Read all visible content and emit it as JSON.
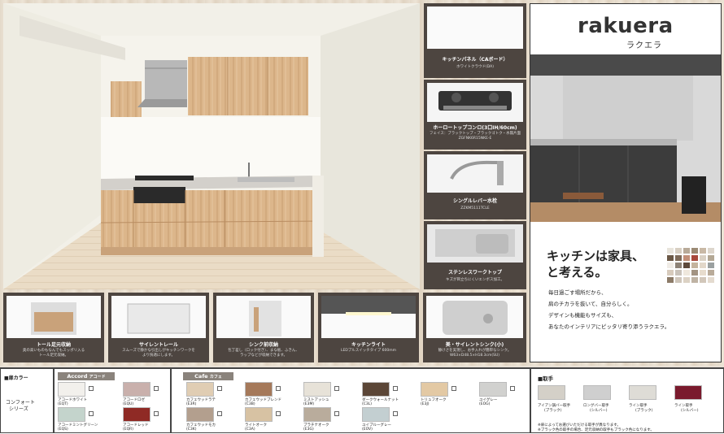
{
  "brand": {
    "logo": "rakuera",
    "logo_kana": "ラクエラ",
    "tagline_1": "キッチンは家具、",
    "tagline_2": "と考える。",
    "copy": [
      "毎日過ごす場所だから、",
      "肩のチカラを抜いて、自分らしく。",
      "デザインも機能もサイズも、",
      "あなたのインテリアにピッタリ寄り添うラクエラ。"
    ],
    "swatch_colors": [
      "#e8e4dc",
      "#d8cfc2",
      "#b8aa98",
      "#9b8a74",
      "#c9b9a6",
      "#ddd6cc",
      "#6b5846",
      "#7e6a58",
      "#c28f78",
      "#a8483c",
      "#d9d0c3",
      "#b3a794",
      "#f0ece6",
      "#8d8276",
      "#5e4a3c",
      "#c4b39d",
      "#e2d7c9",
      "#9aa0a0",
      "#d7cbbd",
      "#c9c2ba",
      "#efe8dd",
      "#a39483",
      "#e7dccd",
      "#b9ab99",
      "#8c7b68",
      "#cfc6bb",
      "#dcd2c4",
      "#bfb3a4",
      "#d2c7ba",
      "#e4dbcf"
    ]
  },
  "side_items": [
    {
      "caption": "キッチンパネル（CAボード）",
      "sub": "ホワイトクラウド(DA)"
    },
    {
      "caption": "ホーロートップコンロ(3口IH/60cm)",
      "sub": "フェイス：ブラックトップ・ブラックゴトク・水無片面\nZGFNK6R15NKE-E"
    },
    {
      "caption": "シングルレバー水栓",
      "sub": "ZZKM5111TCLE"
    },
    {
      "caption": "ステンレスワークトップ",
      "sub": "キズが目立ちにくいエンボス加工。"
    }
  ],
  "features": [
    {
      "caption": "トール足元収納",
      "sub": "奥の高いものもなんでもスッポリ入る\nトール足元収納。"
    },
    {
      "caption": "サイレントレール",
      "sub": "スムーズで静かな引出しがキッチンワークを\nより快適にします。"
    },
    {
      "caption": "シンク前収納",
      "sub": "包丁差し（ロック付き）、まな板、ふきん、\nラップなどが収納できます。"
    },
    {
      "caption": "キッチンライト",
      "sub": "LEDプルスイッチタイプ 600mm"
    },
    {
      "caption": "美・サイレントシンク(小)",
      "sub": "静けさを実現し、お手入れが簡単なシンク。\nW63×D48.5×H18.3cm(SU)"
    }
  ],
  "door_color": {
    "label": "■扉カラー",
    "series_label_1": "コンフォート",
    "series_label_2": "シリーズ",
    "accord": {
      "title": "Accord",
      "title_kana": "アコード",
      "items": [
        {
          "name": "アコードホワイト",
          "code": "(EQT)",
          "color": "#f2f0ec"
        },
        {
          "name": "アコードロゼ",
          "code": "(EQU)",
          "color": "#c9b0ac"
        },
        {
          "name": "アコードミントグリーン",
          "code": "(EQS)",
          "color": "#c4d4cc"
        },
        {
          "name": "アコードレッド",
          "code": "(EQR)",
          "color": "#8f2a25"
        }
      ]
    },
    "cafe": {
      "title": "Cafe",
      "title_kana": "カフェ",
      "items": [
        {
          "name": "カフェウッドラテ",
          "code": "(E3R)",
          "color": "#e0cdb3"
        },
        {
          "name": "カフェウッドブレンド",
          "code": "(C3B)",
          "color": "#a5795a"
        },
        {
          "name": "ミストアッシュ",
          "code": "(E3M)",
          "color": "#e7e2d8"
        },
        {
          "name": "ダークウォールナット",
          "code": "(C3L)",
          "color": "#5b4637"
        },
        {
          "name": "トリュフオーク",
          "code": "(E3J)",
          "color": "#e3c9a4"
        },
        {
          "name": "ユイグレー",
          "code": "(EOG)",
          "color": "#d1d1cf"
        },
        {
          "name": "カフェウッドモカ",
          "code": "(C3K)",
          "color": "#b39f8e"
        },
        {
          "name": "ライトオーク",
          "code": "(C3A)",
          "color": "#d7c2a3"
        },
        {
          "name": "ブラチナオーク",
          "code": "(E3G)",
          "color": "#b9ac9c"
        },
        {
          "name": "ユイブルーグレー",
          "code": "(EOV)",
          "color": "#c3cfd1"
        }
      ]
    }
  },
  "handle": {
    "label": "■取手",
    "items": [
      {
        "name": "アイアン調バー取手",
        "sub": "(ブラック)",
        "color": "#d4d0c8"
      },
      {
        "name": "ロングバー取手",
        "sub": "(シルバー)",
        "color": "#cfcfcf"
      },
      {
        "name": "ライン取手",
        "sub": "(ブラック)",
        "color": "#dedcd6"
      },
      {
        "name": "ライン取手",
        "sub": "(シルバー)",
        "color": "#7a1a2d"
      }
    ],
    "note_1": "※扉によってお選びいただける取手が異なります。",
    "note_2": "※ブラック色の取手の場合、足元収納の取手もブラック色になります。"
  },
  "colors": {
    "panel": "#4d4540",
    "wood": "#d9b48a"
  }
}
